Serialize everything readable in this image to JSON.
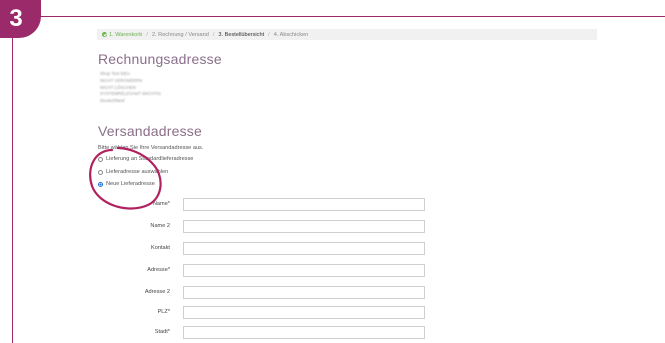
{
  "step_badge": "3",
  "breadcrumb": {
    "steps": [
      "1. Warenkorb",
      "2. Rechnung / Versand",
      "3. Bestellübersicht",
      "4. Abschicken"
    ],
    "separator": "/"
  },
  "billing": {
    "title": "Rechnungsadresse",
    "address_lines": [
      "Shop Test DEU",
      "NICHT VERÄNDERN",
      "NICHT LÖSCHEN",
      "SYSTEMRELEVANT WICHTIG",
      "Deutschland"
    ]
  },
  "shipping": {
    "title": "Versandadresse",
    "instruction": "Bitte wählen Sie Ihre Versandadresse aus.",
    "options": [
      {
        "label": "Lieferung an Standardlieferadresse",
        "checked": false
      },
      {
        "label": "Lieferadresse auswählen",
        "checked": false
      },
      {
        "label": "Neue Lieferadresse",
        "checked": true
      }
    ]
  },
  "form": {
    "fields": [
      {
        "label": "Name*",
        "value": ""
      },
      {
        "label": "Name 2",
        "value": ""
      },
      {
        "label": "Kontakt",
        "value": ""
      },
      {
        "label": "Adresse*",
        "value": ""
      },
      {
        "label": "Adresse 2",
        "value": ""
      },
      {
        "label": "PLZ*",
        "value": ""
      },
      {
        "label": "Stadt*",
        "value": ""
      }
    ]
  },
  "colors": {
    "accent": "#9b2a6a",
    "done": "#6ab04c",
    "radio_selected": "#1f6fd6",
    "heading": "#8a6f8a"
  }
}
